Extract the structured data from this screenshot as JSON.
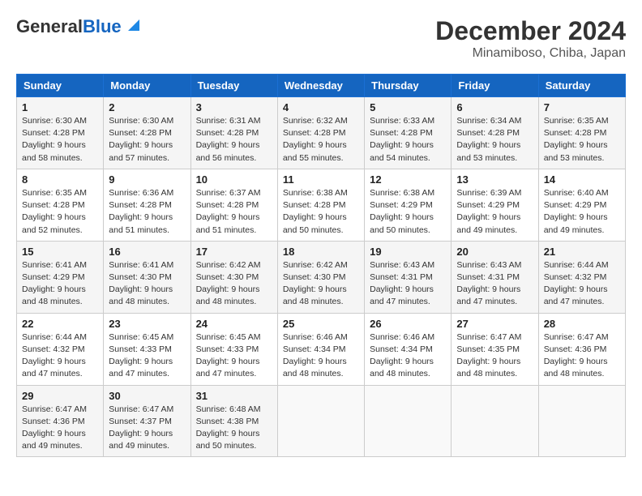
{
  "header": {
    "logo_general": "General",
    "logo_blue": "Blue",
    "title": "December 2024",
    "subtitle": "Minamiboso, Chiba, Japan"
  },
  "columns": [
    "Sunday",
    "Monday",
    "Tuesday",
    "Wednesday",
    "Thursday",
    "Friday",
    "Saturday"
  ],
  "weeks": [
    [
      {
        "day": "1",
        "sunrise": "6:30 AM",
        "sunset": "4:28 PM",
        "daylight": "9 hours and 58 minutes."
      },
      {
        "day": "2",
        "sunrise": "6:30 AM",
        "sunset": "4:28 PM",
        "daylight": "9 hours and 57 minutes."
      },
      {
        "day": "3",
        "sunrise": "6:31 AM",
        "sunset": "4:28 PM",
        "daylight": "9 hours and 56 minutes."
      },
      {
        "day": "4",
        "sunrise": "6:32 AM",
        "sunset": "4:28 PM",
        "daylight": "9 hours and 55 minutes."
      },
      {
        "day": "5",
        "sunrise": "6:33 AM",
        "sunset": "4:28 PM",
        "daylight": "9 hours and 54 minutes."
      },
      {
        "day": "6",
        "sunrise": "6:34 AM",
        "sunset": "4:28 PM",
        "daylight": "9 hours and 53 minutes."
      },
      {
        "day": "7",
        "sunrise": "6:35 AM",
        "sunset": "4:28 PM",
        "daylight": "9 hours and 53 minutes."
      }
    ],
    [
      {
        "day": "8",
        "sunrise": "6:35 AM",
        "sunset": "4:28 PM",
        "daylight": "9 hours and 52 minutes."
      },
      {
        "day": "9",
        "sunrise": "6:36 AM",
        "sunset": "4:28 PM",
        "daylight": "9 hours and 51 minutes."
      },
      {
        "day": "10",
        "sunrise": "6:37 AM",
        "sunset": "4:28 PM",
        "daylight": "9 hours and 51 minutes."
      },
      {
        "day": "11",
        "sunrise": "6:38 AM",
        "sunset": "4:28 PM",
        "daylight": "9 hours and 50 minutes."
      },
      {
        "day": "12",
        "sunrise": "6:38 AM",
        "sunset": "4:29 PM",
        "daylight": "9 hours and 50 minutes."
      },
      {
        "day": "13",
        "sunrise": "6:39 AM",
        "sunset": "4:29 PM",
        "daylight": "9 hours and 49 minutes."
      },
      {
        "day": "14",
        "sunrise": "6:40 AM",
        "sunset": "4:29 PM",
        "daylight": "9 hours and 49 minutes."
      }
    ],
    [
      {
        "day": "15",
        "sunrise": "6:41 AM",
        "sunset": "4:29 PM",
        "daylight": "9 hours and 48 minutes."
      },
      {
        "day": "16",
        "sunrise": "6:41 AM",
        "sunset": "4:30 PM",
        "daylight": "9 hours and 48 minutes."
      },
      {
        "day": "17",
        "sunrise": "6:42 AM",
        "sunset": "4:30 PM",
        "daylight": "9 hours and 48 minutes."
      },
      {
        "day": "18",
        "sunrise": "6:42 AM",
        "sunset": "4:30 PM",
        "daylight": "9 hours and 48 minutes."
      },
      {
        "day": "19",
        "sunrise": "6:43 AM",
        "sunset": "4:31 PM",
        "daylight": "9 hours and 47 minutes."
      },
      {
        "day": "20",
        "sunrise": "6:43 AM",
        "sunset": "4:31 PM",
        "daylight": "9 hours and 47 minutes."
      },
      {
        "day": "21",
        "sunrise": "6:44 AM",
        "sunset": "4:32 PM",
        "daylight": "9 hours and 47 minutes."
      }
    ],
    [
      {
        "day": "22",
        "sunrise": "6:44 AM",
        "sunset": "4:32 PM",
        "daylight": "9 hours and 47 minutes."
      },
      {
        "day": "23",
        "sunrise": "6:45 AM",
        "sunset": "4:33 PM",
        "daylight": "9 hours and 47 minutes."
      },
      {
        "day": "24",
        "sunrise": "6:45 AM",
        "sunset": "4:33 PM",
        "daylight": "9 hours and 47 minutes."
      },
      {
        "day": "25",
        "sunrise": "6:46 AM",
        "sunset": "4:34 PM",
        "daylight": "9 hours and 48 minutes."
      },
      {
        "day": "26",
        "sunrise": "6:46 AM",
        "sunset": "4:34 PM",
        "daylight": "9 hours and 48 minutes."
      },
      {
        "day": "27",
        "sunrise": "6:47 AM",
        "sunset": "4:35 PM",
        "daylight": "9 hours and 48 minutes."
      },
      {
        "day": "28",
        "sunrise": "6:47 AM",
        "sunset": "4:36 PM",
        "daylight": "9 hours and 48 minutes."
      }
    ],
    [
      {
        "day": "29",
        "sunrise": "6:47 AM",
        "sunset": "4:36 PM",
        "daylight": "9 hours and 49 minutes."
      },
      {
        "day": "30",
        "sunrise": "6:47 AM",
        "sunset": "4:37 PM",
        "daylight": "9 hours and 49 minutes."
      },
      {
        "day": "31",
        "sunrise": "6:48 AM",
        "sunset": "4:38 PM",
        "daylight": "9 hours and 50 minutes."
      },
      null,
      null,
      null,
      null
    ]
  ]
}
